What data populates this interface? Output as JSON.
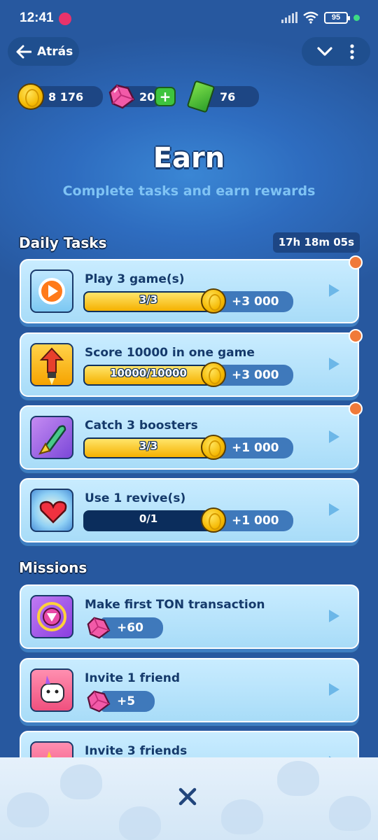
{
  "statusbar": {
    "time": "12:41",
    "battery": "95"
  },
  "nav": {
    "back_label": "Atrás"
  },
  "currency": {
    "coins": "8 176",
    "gems": "20",
    "tickets": "76"
  },
  "header": {
    "title": "Earn",
    "subtitle": "Complete tasks and earn rewards"
  },
  "daily": {
    "title": "Daily Tasks",
    "timer": "17h 18m 05s",
    "tasks": [
      {
        "label": "Play 3 game(s)",
        "progress_text": "3/3",
        "progress": 1.0,
        "reward": "+3 000",
        "icon": "play-icon"
      },
      {
        "label": "Score 10000 in one game",
        "progress_text": "10000/10000",
        "progress": 1.0,
        "reward": "+3 000",
        "icon": "rocket-icon"
      },
      {
        "label": "Catch 3 boosters",
        "progress_text": "3/3",
        "progress": 1.0,
        "reward": "+1 000",
        "icon": "booster-icon"
      },
      {
        "label": "Use 1 revive(s)",
        "progress_text": "0/1",
        "progress": 0.0,
        "reward": "+1 000",
        "icon": "heart-icon"
      }
    ]
  },
  "missions": {
    "title": "Missions",
    "items": [
      {
        "label": "Make first TON transaction",
        "reward": "+60",
        "icon": "ton-icon"
      },
      {
        "label": "Invite 1 friend",
        "reward": "+5",
        "icon": "friend-icon"
      },
      {
        "label": "Invite 3 friends",
        "icon": "friends-icon"
      }
    ]
  },
  "colors": {
    "accent": "#2e6cbf",
    "gold": "#f5b800",
    "notification": "#f07a3a"
  }
}
